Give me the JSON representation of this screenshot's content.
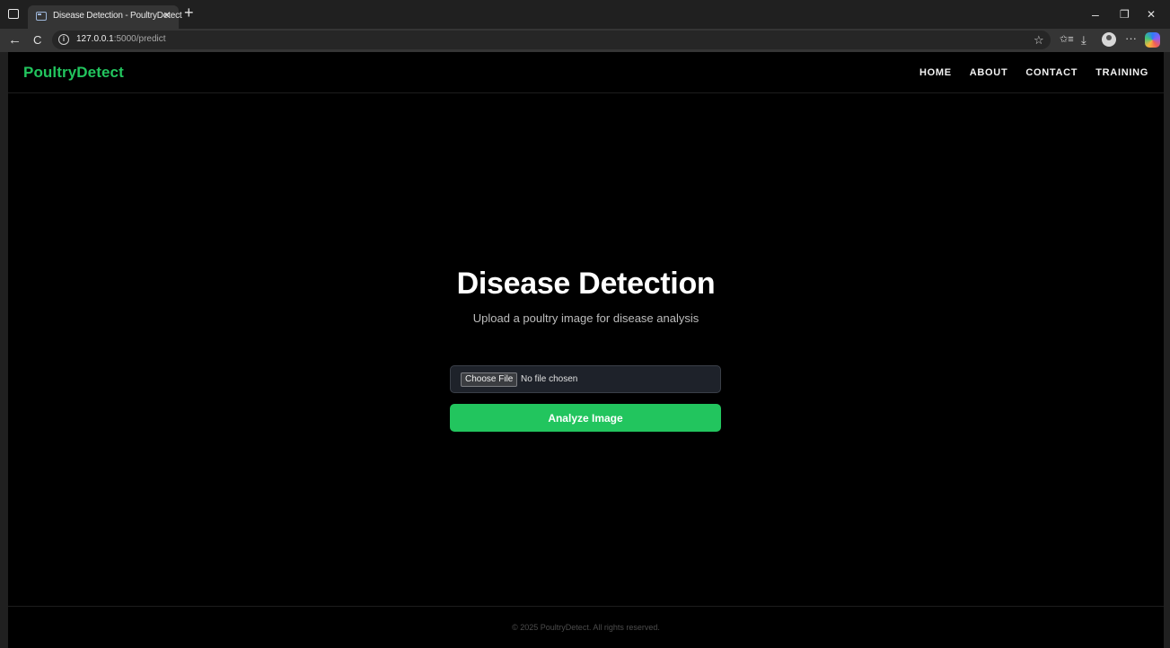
{
  "browser": {
    "tab_title": "Disease Detection - PoultryDetect",
    "tab_close": "×",
    "new_tab": "+",
    "url_host": "127.0.0.1",
    "url_rest": ":5000/predict",
    "icons": {
      "back": "←",
      "refresh": "C",
      "favorite": "☆",
      "favorites_bar": "✩≡",
      "downloads": "⤓",
      "more": "···",
      "minimize": "–",
      "restore": "❐",
      "close": "✕"
    }
  },
  "site": {
    "brand": "PoultryDetect",
    "nav": [
      "HOME",
      "ABOUT",
      "CONTACT",
      "TRAINING"
    ],
    "brand_color": "#22c55e"
  },
  "page": {
    "title": "Disease Detection",
    "subtitle": "Upload a poultry image for disease analysis",
    "file_input": {
      "button_label": "Choose File",
      "status": "No file chosen"
    },
    "analyze_button": "Analyze Image"
  },
  "footer": {
    "text": "© 2025 PoultryDetect. All rights reserved."
  }
}
